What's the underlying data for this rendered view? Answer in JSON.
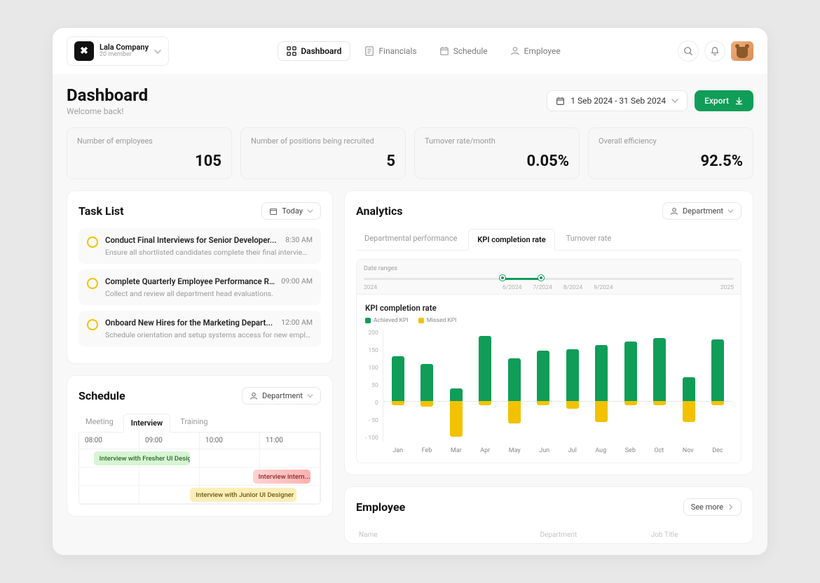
{
  "company": {
    "name": "Lala Company",
    "subtitle": "20 member"
  },
  "nav": {
    "items": [
      {
        "label": "Dashboard"
      },
      {
        "label": "Financials"
      },
      {
        "label": "Schedule"
      },
      {
        "label": "Employee"
      }
    ]
  },
  "dashboard": {
    "title": "Dashboard",
    "subtitle": "Welcome back!",
    "date_range": "1 Seb 2024 - 31 Seb 2024",
    "export_label": "Export"
  },
  "stats": [
    {
      "label": "Number of employees",
      "value": "105"
    },
    {
      "label": "Number of positions being recruited",
      "value": "5"
    },
    {
      "label": "Turnover rate/month",
      "value": "0.05%"
    },
    {
      "label": "Overall efficiency",
      "value": "92.5%"
    }
  ],
  "tasklist": {
    "title": "Task List",
    "filter": "Today",
    "items": [
      {
        "title": "Conduct Final Interviews for Senior Developer...",
        "time": "8:30 AM",
        "desc": "Ensure all shortlisted candidates complete their final interviews."
      },
      {
        "title": "Complete Quarterly Employee Performance R...",
        "time": "09:00 AM",
        "desc": "Collect and review all department head evaluations."
      },
      {
        "title": "Onboard New Hires for the Marketing Depart...",
        "time": "12:00 AM",
        "desc": "Schedule orientation and setup systems access for new employees."
      }
    ]
  },
  "schedule": {
    "title": "Schedule",
    "filter": "Department",
    "tabs": [
      "Meeting",
      "Interview",
      "Training"
    ],
    "active_tab": "Interview",
    "time_slots": [
      "08:00",
      "09:00",
      "10:00",
      "11:00"
    ],
    "events": [
      {
        "label": "Interview with Fresher UI Design...",
        "row": 0,
        "start_pct": 6,
        "width_pct": 40,
        "color": "green"
      },
      {
        "label": "Interview intern...",
        "row": 1,
        "start_pct": 72,
        "width_pct": 24,
        "color": "red"
      },
      {
        "label": "Interview with Junior UI Designer",
        "row": 2,
        "start_pct": 46,
        "width_pct": 44,
        "color": "yellow"
      }
    ]
  },
  "analytics": {
    "title": "Analytics",
    "filter": "Department",
    "tabs": [
      "Departmental performance",
      "KPI completion rate",
      "Turnover rate"
    ],
    "active_tab": "KPI completion rate",
    "range": {
      "label": "Date ranges",
      "start_tick": "2024",
      "end_tick": "2025",
      "mid_ticks": [
        "6/2024",
        "7/2024",
        "8/2024",
        "9/2024"
      ],
      "fill_start_pct": 37.5,
      "fill_end_pct": 48
    },
    "chart_title": "KPI completion rate",
    "legend": [
      {
        "label": "Achieved KPI",
        "color": "green"
      },
      {
        "label": "Missed KPI",
        "color": "amber"
      }
    ]
  },
  "chart_data": {
    "type": "bar",
    "title": "KPI completion rate",
    "xlabel": "",
    "ylabel": "",
    "ylim": [
      -100,
      200
    ],
    "y_ticks": [
      200,
      150,
      100,
      50,
      0,
      -50,
      -100
    ],
    "categories": [
      "Jan",
      "Feb",
      "Mar",
      "Apr",
      "May",
      "Jun",
      "Jul",
      "Aug",
      "Seb",
      "Oct",
      "Nov",
      "Dec"
    ],
    "series": [
      {
        "name": "Achieved KPI",
        "color": "#0f9d58",
        "values": [
          120,
          100,
          35,
          175,
          115,
          135,
          140,
          150,
          160,
          170,
          65,
          165
        ]
      },
      {
        "name": "Missed KPI",
        "color": "#f2c200",
        "values": [
          -10,
          -15,
          -95,
          -10,
          -60,
          -10,
          -20,
          -55,
          -10,
          -10,
          -55,
          -10
        ]
      }
    ]
  },
  "employee": {
    "title": "Employee",
    "see_more": "See more",
    "columns": [
      "Name",
      "Department",
      "Job Title"
    ]
  },
  "colors": {
    "accent_green": "#0f9d58",
    "accent_amber": "#f2c200"
  }
}
